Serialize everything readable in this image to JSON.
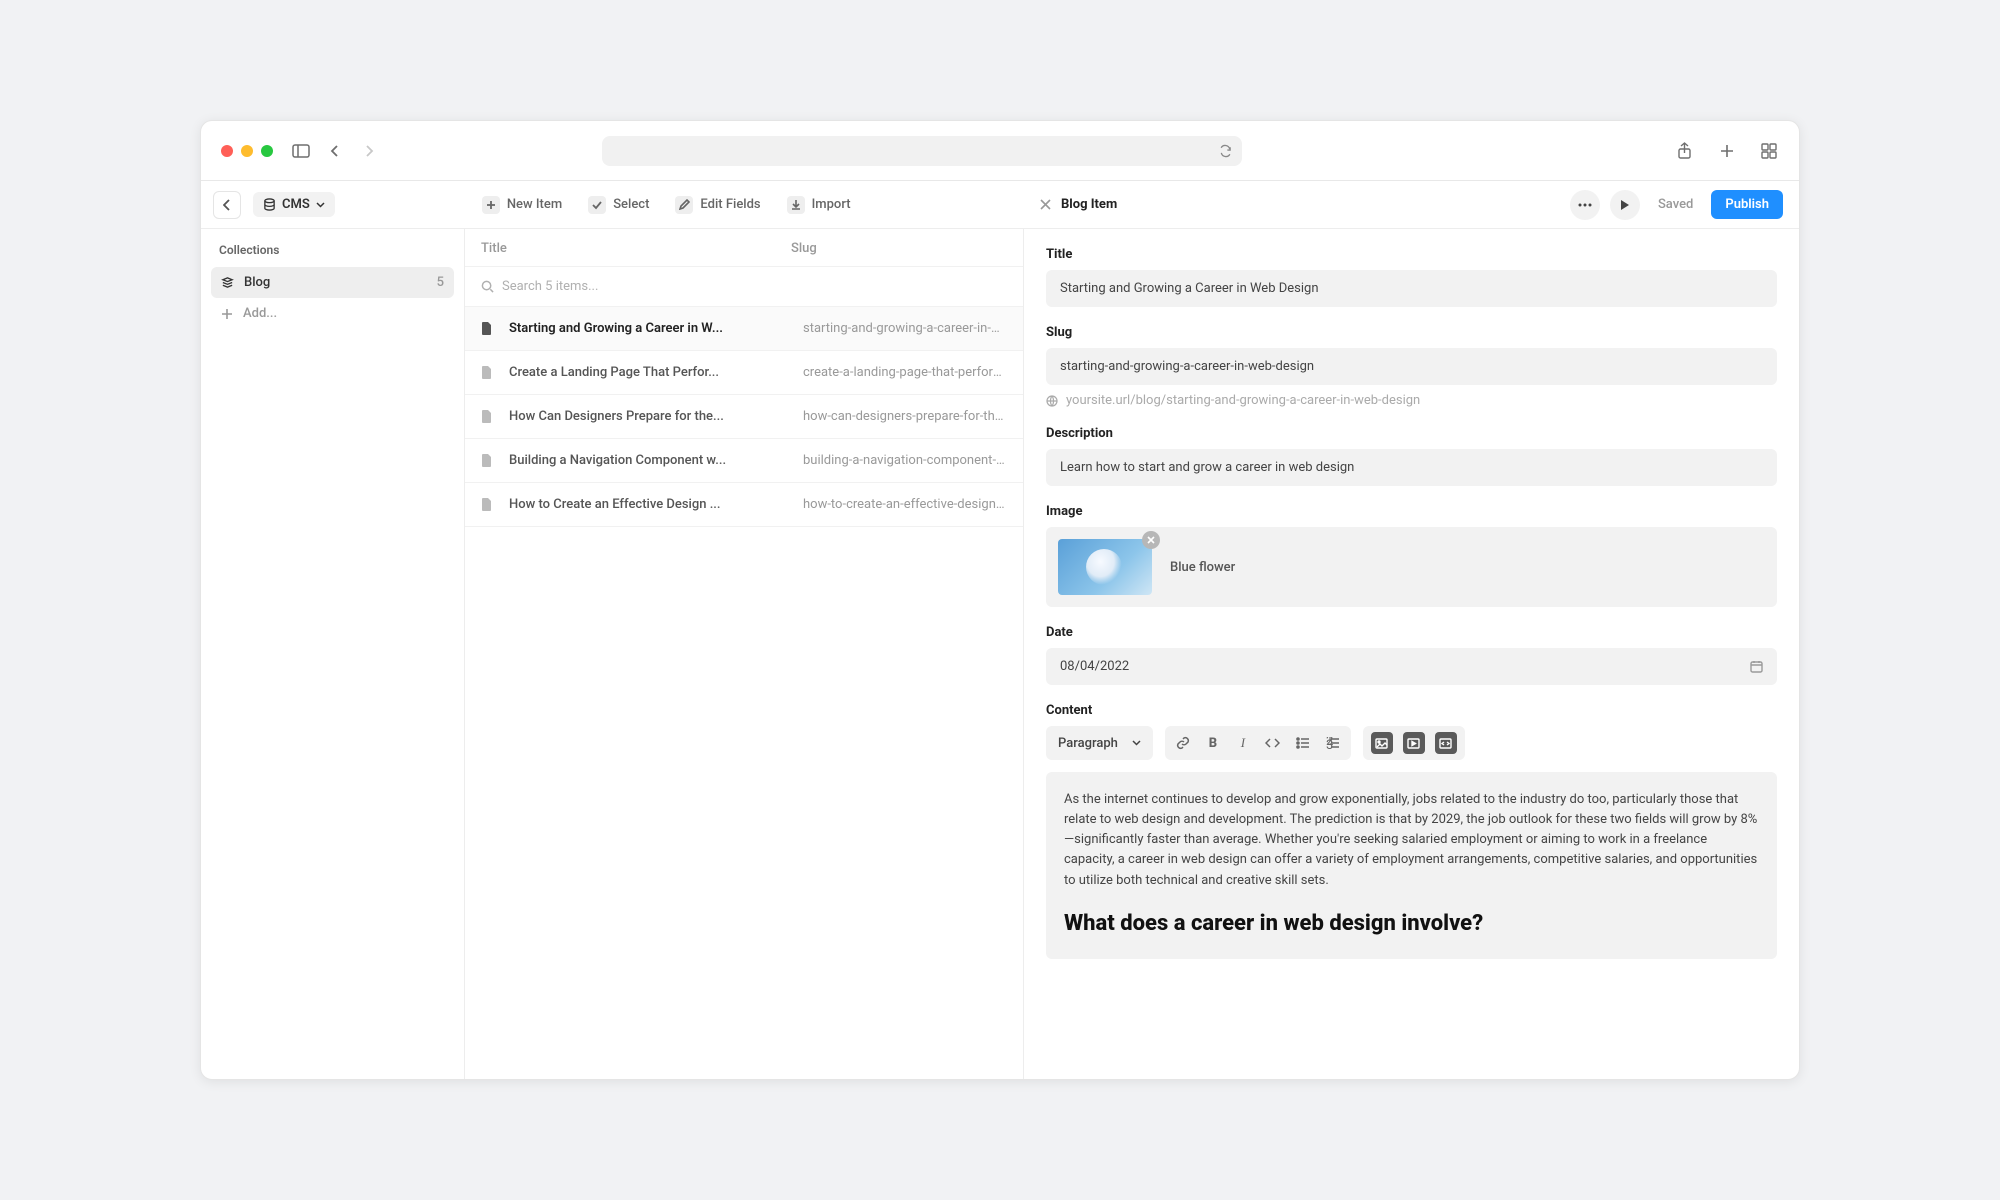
{
  "cms_label": "CMS",
  "toolbar": {
    "new_item": "New Item",
    "select": "Select",
    "edit_fields": "Edit Fields",
    "import": "Import"
  },
  "sidebar": {
    "heading": "Collections",
    "blog_label": "Blog",
    "blog_count": "5",
    "add_label": "Add..."
  },
  "list": {
    "col_title": "Title",
    "col_slug": "Slug",
    "search_placeholder": "Search 5 items...",
    "items": [
      {
        "title": "Starting and Growing a Career in W...",
        "slug": "starting-and-growing-a-career-in-web-design"
      },
      {
        "title": "Create a Landing Page That Perfor...",
        "slug": "create-a-landing-page-that-performs"
      },
      {
        "title": "How Can Designers Prepare for the...",
        "slug": "how-can-designers-prepare-for-the-future"
      },
      {
        "title": "Building a Navigation Component w...",
        "slug": "building-a-navigation-component-with-variables"
      },
      {
        "title": "How to Create an Effective Design ...",
        "slug": "how-to-create-an-effective-design-portfolio"
      }
    ]
  },
  "panel": {
    "header_title": "Blog Item",
    "saved": "Saved",
    "publish": "Publish",
    "fields": {
      "title_label": "Title",
      "title_value": "Starting and Growing a Career in Web Design",
      "slug_label": "Slug",
      "slug_value": "starting-and-growing-a-career-in-web-design",
      "url_preview": "yoursite.url/blog/starting-and-growing-a-career-in-web-design",
      "desc_label": "Description",
      "desc_value": "Learn how to start and grow a career in web design",
      "image_label": "Image",
      "image_name": "Blue flower",
      "date_label": "Date",
      "date_value": "08/04/2022",
      "content_label": "Content",
      "style_dropdown": "Paragraph",
      "content_p1": "As the internet continues to develop and grow exponentially, jobs related to the industry do too, particularly those that relate to web design and development. The prediction is that by 2029, the job outlook for these two fields will grow by 8%—significantly faster than average. Whether you're seeking salaried employment or aiming to work in a freelance capacity, a career in web design can offer a variety of employment arrangements, competitive salaries, and opportunities to utilize both technical and creative skill sets.",
      "content_h2": "What does a career in web design involve?"
    }
  }
}
